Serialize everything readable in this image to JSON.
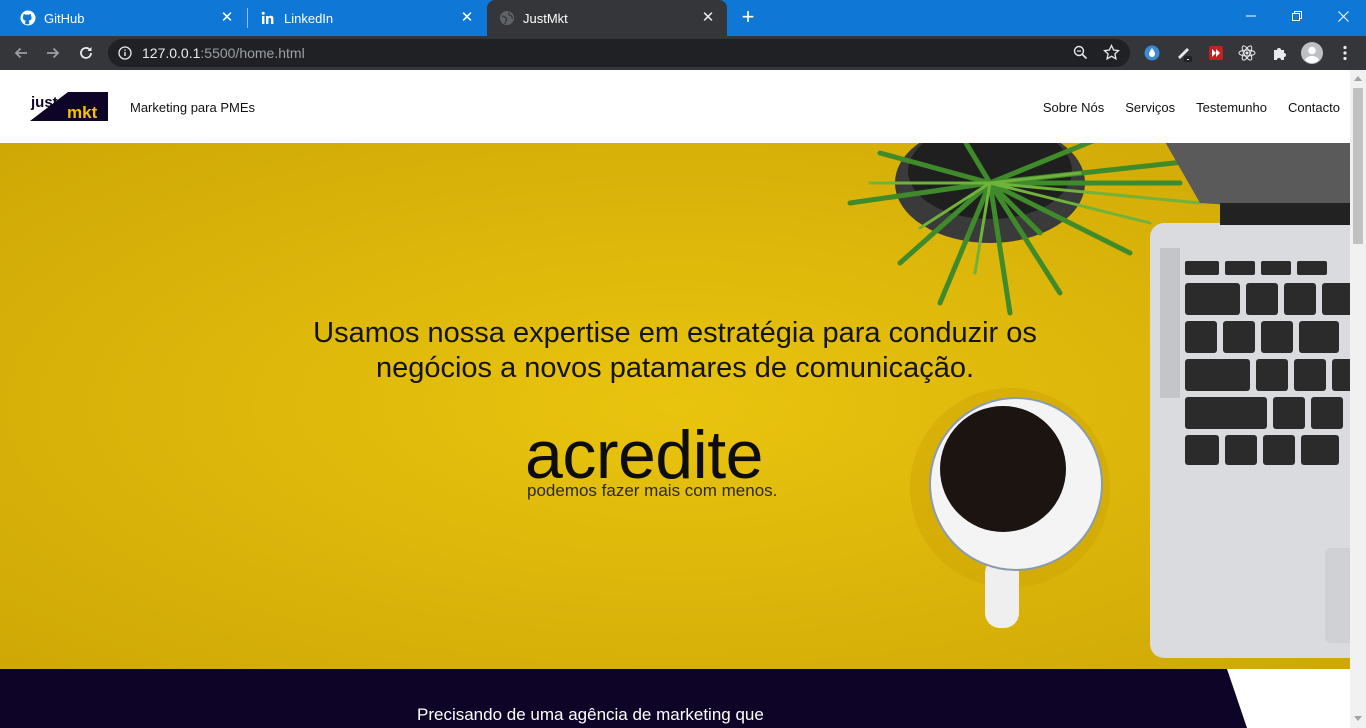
{
  "browser": {
    "tabs": [
      {
        "title": "GitHub",
        "icon": "github-icon"
      },
      {
        "title": "LinkedIn",
        "icon": "linkedin-icon"
      },
      {
        "title": "JustMkt",
        "icon": "globe-icon",
        "active": true
      }
    ],
    "url_host": "127.0.0.1",
    "url_path": ":5500/home.html"
  },
  "site": {
    "logo": {
      "word1": "just",
      "word2": "mkt"
    },
    "tagline": "Marketing para PMEs",
    "nav": [
      "Sobre Nós",
      "Serviços",
      "Testemunho",
      "Contacto"
    ]
  },
  "hero": {
    "headline_line1": "Usamos nossa expertise em estratégia para conduzir os",
    "headline_line2": "negócios a novos patamares de comunicação.",
    "big_word": "acredite",
    "subtext": "podemos fazer mais com menos."
  },
  "cta": {
    "text": "Precisando de uma agência de marketing que"
  },
  "colors": {
    "tabstrip": "#0f78d7",
    "hero_yellow": "#e3bd0a",
    "cta_navy": "#0e0428",
    "logo_yellow": "#f2c300"
  }
}
